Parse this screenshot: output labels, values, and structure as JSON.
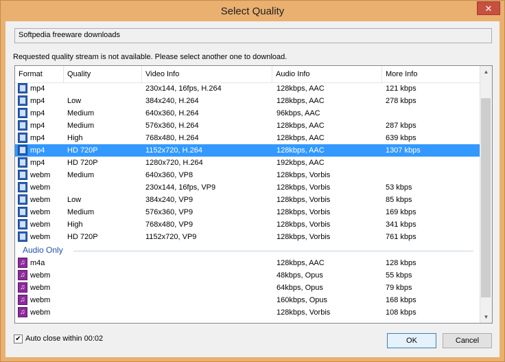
{
  "window": {
    "title": "Select Quality",
    "close_label": "✕"
  },
  "source_text": "Softpedia freeware downloads",
  "message": "Requested quality stream is not available. Please select another one to download.",
  "columns": [
    "Format",
    "Quality",
    "Video Info",
    "Audio Info",
    "More Info"
  ],
  "video_rows": [
    {
      "format": "mp4",
      "quality": "",
      "video": "230x144, 16fps, H.264",
      "audio": "128kbps, AAC",
      "more": "121 kbps",
      "selected": false
    },
    {
      "format": "mp4",
      "quality": "Low",
      "video": "384x240, H.264",
      "audio": "128kbps, AAC",
      "more": "278 kbps",
      "selected": false
    },
    {
      "format": "mp4",
      "quality": "Medium",
      "video": "640x360, H.264",
      "audio": "96kbps, AAC",
      "more": "",
      "selected": false
    },
    {
      "format": "mp4",
      "quality": "Medium",
      "video": "576x360, H.264",
      "audio": "128kbps, AAC",
      "more": "287 kbps",
      "selected": false
    },
    {
      "format": "mp4",
      "quality": "High",
      "video": "768x480, H.264",
      "audio": "128kbps, AAC",
      "more": "639 kbps",
      "selected": false
    },
    {
      "format": "mp4",
      "quality": "HD 720P",
      "video": "1152x720, H.264",
      "audio": "128kbps, AAC",
      "more": "1307 kbps",
      "selected": true
    },
    {
      "format": "mp4",
      "quality": "HD 720P",
      "video": "1280x720, H.264",
      "audio": "192kbps, AAC",
      "more": "",
      "selected": false
    },
    {
      "format": "webm",
      "quality": "Medium",
      "video": "640x360, VP8",
      "audio": "128kbps, Vorbis",
      "more": "",
      "selected": false
    },
    {
      "format": "webm",
      "quality": "",
      "video": "230x144, 16fps, VP9",
      "audio": "128kbps, Vorbis",
      "more": "53 kbps",
      "selected": false
    },
    {
      "format": "webm",
      "quality": "Low",
      "video": "384x240, VP9",
      "audio": "128kbps, Vorbis",
      "more": "85 kbps",
      "selected": false
    },
    {
      "format": "webm",
      "quality": "Medium",
      "video": "576x360, VP9",
      "audio": "128kbps, Vorbis",
      "more": "169 kbps",
      "selected": false
    },
    {
      "format": "webm",
      "quality": "High",
      "video": "768x480, VP9",
      "audio": "128kbps, Vorbis",
      "more": "341 kbps",
      "selected": false
    },
    {
      "format": "webm",
      "quality": "HD 720P",
      "video": "1152x720, VP9",
      "audio": "128kbps, Vorbis",
      "more": "761 kbps",
      "selected": false
    }
  ],
  "audio_group_label": "Audio Only",
  "audio_rows": [
    {
      "format": "m4a",
      "quality": "",
      "video": "",
      "audio": "128kbps, AAC",
      "more": "128 kbps"
    },
    {
      "format": "webm",
      "quality": "",
      "video": "",
      "audio": "48kbps, Opus",
      "more": "55 kbps"
    },
    {
      "format": "webm",
      "quality": "",
      "video": "",
      "audio": "64kbps, Opus",
      "more": "79 kbps"
    },
    {
      "format": "webm",
      "quality": "",
      "video": "",
      "audio": "160kbps, Opus",
      "more": "168 kbps"
    },
    {
      "format": "webm",
      "quality": "",
      "video": "",
      "audio": "128kbps, Vorbis",
      "more": "108 kbps"
    }
  ],
  "auto_close": {
    "checked": true,
    "check_mark": "✔",
    "label": "Auto close within 00:02"
  },
  "buttons": {
    "ok": "OK",
    "cancel": "Cancel"
  },
  "colors": {
    "title_bar": "#e9b070",
    "selection": "#3399ff",
    "group_label": "#1e4fa8"
  }
}
